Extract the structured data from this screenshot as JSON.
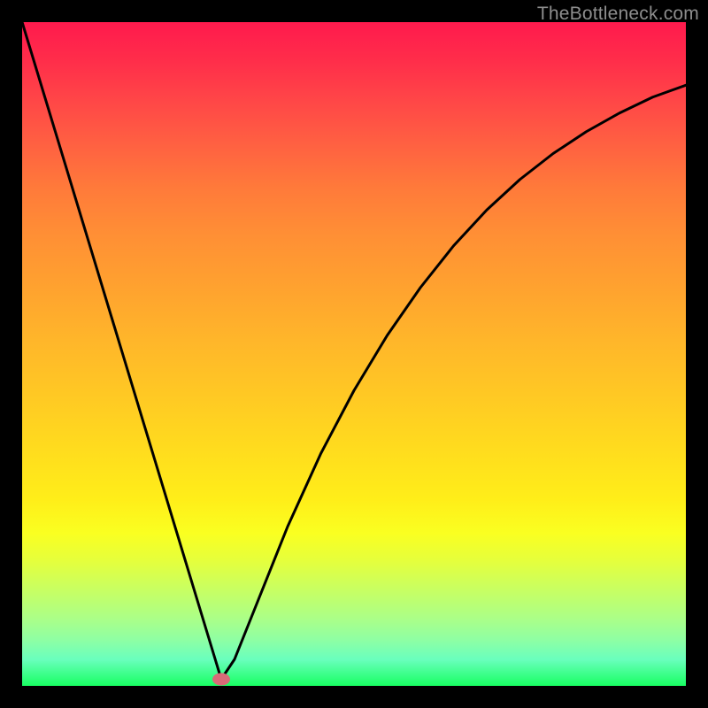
{
  "watermark": "TheBottleneck.com",
  "colors": {
    "frame": "#000000",
    "curve": "#000000",
    "marker": "#d86b78",
    "gradient_top": "#ff1a4d",
    "gradient_bottom": "#18ff62"
  },
  "chart_data": {
    "type": "line",
    "title": "",
    "xlabel": "",
    "ylabel": "",
    "xlim": [
      0,
      100
    ],
    "ylim": [
      0,
      100
    ],
    "series": [
      {
        "name": "bottleneck-curve",
        "x": [
          0,
          5,
          10,
          15,
          20,
          25,
          27,
          29,
          30,
          32,
          35,
          40,
          45,
          50,
          55,
          60,
          65,
          70,
          75,
          80,
          85,
          90,
          95,
          100
        ],
        "values": [
          100,
          83.5,
          67.0,
          50.5,
          34.0,
          17.5,
          10.9,
          4.3,
          1.0,
          4.0,
          11.5,
          24.0,
          35.0,
          44.5,
          52.8,
          60.0,
          66.3,
          71.7,
          76.3,
          80.2,
          83.5,
          86.3,
          88.7,
          90.5
        ]
      }
    ],
    "marker": {
      "x": 30,
      "y": 1.0,
      "color": "#d86b78"
    },
    "grid": false,
    "legend": false,
    "gradient_background": true
  }
}
